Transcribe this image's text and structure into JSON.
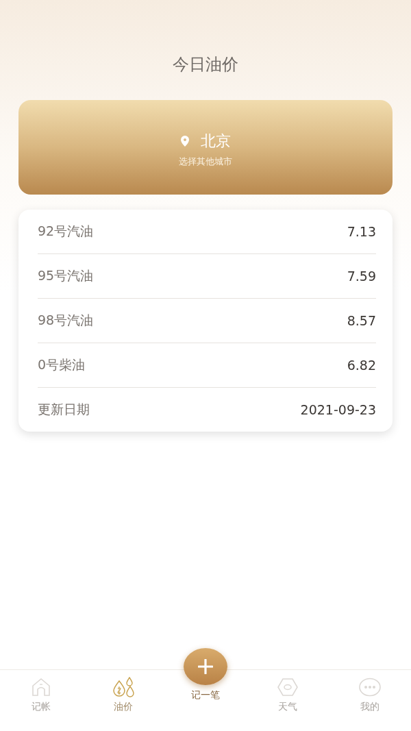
{
  "header": {
    "title": "今日油价"
  },
  "city_card": {
    "city": "北京",
    "hint": "选择其他城市"
  },
  "prices": [
    {
      "label": "92号汽油",
      "value": "7.13"
    },
    {
      "label": "95号汽油",
      "value": "7.59"
    },
    {
      "label": "98号汽油",
      "value": "8.57"
    },
    {
      "label": "0号柴油",
      "value": "6.82"
    },
    {
      "label": "更新日期",
      "value": "2021-09-23"
    }
  ],
  "tab_bar": [
    {
      "kind": "home",
      "label": "记帐",
      "selected": false
    },
    {
      "kind": "oil",
      "label": "油价",
      "selected": true
    },
    {
      "kind": "add",
      "label": "记一笔"
    },
    {
      "kind": "weather",
      "label": "天气",
      "selected": false
    },
    {
      "kind": "more",
      "label": "我的",
      "selected": false
    }
  ]
}
